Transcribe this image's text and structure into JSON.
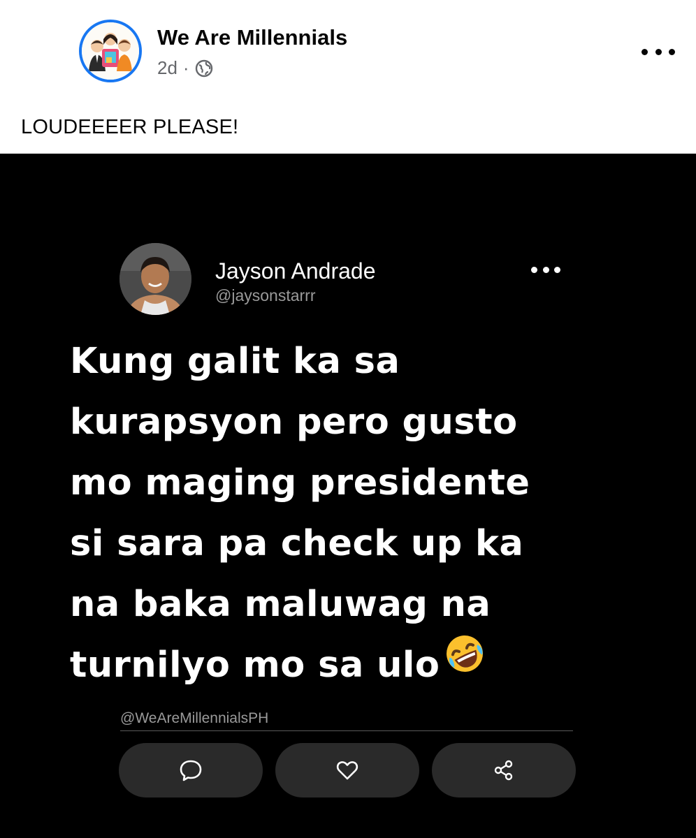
{
  "post": {
    "page_name": "We Are Millennials",
    "time": "2d",
    "separator": "·",
    "audience_icon": "globe-icon",
    "more_icon": "more-horizontal-icon",
    "caption": "LOUDEEEER PLEASE!"
  },
  "image": {
    "author_name": "Jayson Andrade",
    "author_handle": "@jaysonstarrr",
    "tweet_text": "Kung galit ka sa\nkurapsyon pero gusto\nmo maging presidente\nsi sara pa check up ka\nna baka maluwag na\nturnilyo mo sa ulo",
    "emoji_icon": "rolling-on-floor-laughing-emoji",
    "watermark": "@WeAreMillennialsPH",
    "actions": [
      {
        "name": "comment",
        "icon": "comment-icon"
      },
      {
        "name": "like",
        "icon": "heart-icon"
      },
      {
        "name": "share",
        "icon": "share-icon"
      }
    ],
    "colors": {
      "background": "#000000",
      "button": "#2a2a2a",
      "text": "#ffffff",
      "muted": "#9a9a9a"
    }
  },
  "colors": {
    "accent": "#1877f2",
    "text": "#050505",
    "secondary": "#65676b"
  }
}
